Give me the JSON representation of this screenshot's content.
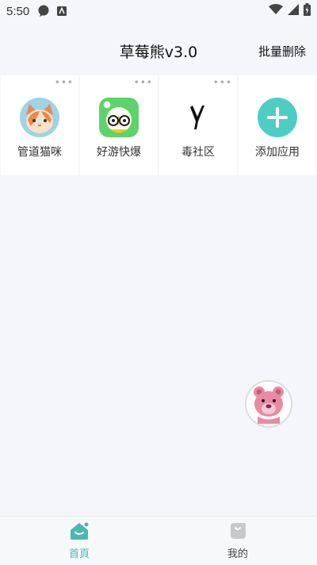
{
  "status_bar": {
    "time": "5:50",
    "icons": [
      "chat-bubble-icon",
      "keyboard-icon",
      "wifi-icon",
      "signal-icon",
      "battery-icon"
    ]
  },
  "header": {
    "title": "草莓熊v3.0",
    "batch_delete": "批量删除"
  },
  "apps": [
    {
      "label": "管道猫咪",
      "icon": "cat-icon"
    },
    {
      "label": "好游快爆",
      "icon": "game-face-icon"
    },
    {
      "label": "毒社区",
      "icon": "y-logo-icon"
    },
    {
      "label": "添加应用",
      "icon": "add-icon"
    }
  ],
  "more_glyph": "•••",
  "float_button": {
    "icon": "lotso-bear-icon"
  },
  "tabbar": {
    "home": "首頁",
    "mine": "我的"
  },
  "colors": {
    "accent": "#4ab8b0",
    "add_circle": "#4ecdc4",
    "background": "#f5f6f9"
  }
}
